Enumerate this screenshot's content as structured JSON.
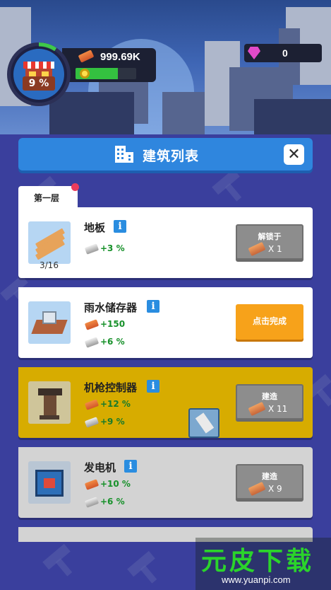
{
  "hud": {
    "progress_percent": "9 %",
    "progress_fraction": 0.09,
    "brick_amount": "999.69K",
    "gem_amount": "0"
  },
  "header": {
    "title": "建筑列表",
    "close_label": "✕"
  },
  "tabs": [
    {
      "label": "第一层",
      "has_notification": true
    }
  ],
  "buildings": [
    {
      "name": "地板",
      "stats": [
        "+3 %"
      ],
      "stat_icons": [
        "plank"
      ],
      "count": "3/16",
      "button": {
        "top": "解锁于",
        "bottom": "X 1",
        "style": "grey"
      },
      "card_style": "white"
    },
    {
      "name": "雨水储存器",
      "stats": [
        "+150",
        "+6 %"
      ],
      "stat_icons": [
        "brick",
        "plank"
      ],
      "button": {
        "label": "点击完成",
        "style": "orange"
      },
      "card_style": "white"
    },
    {
      "name": "机枪控制器",
      "stats": [
        "+12 %",
        "+9 %"
      ],
      "stat_icons": [
        "brick",
        "plank"
      ],
      "button": {
        "top": "建造",
        "bottom": "X 11",
        "style": "grey"
      },
      "card_style": "gold"
    },
    {
      "name": "发电机",
      "stats": [
        "+10 %",
        "+6 %"
      ],
      "stat_icons": [
        "brick",
        "plank"
      ],
      "button": {
        "top": "建造",
        "bottom": "X 9",
        "style": "grey"
      },
      "card_style": "grey"
    }
  ],
  "watermark": {
    "title": "元皮下载",
    "url": "www.yuanpi.com"
  }
}
